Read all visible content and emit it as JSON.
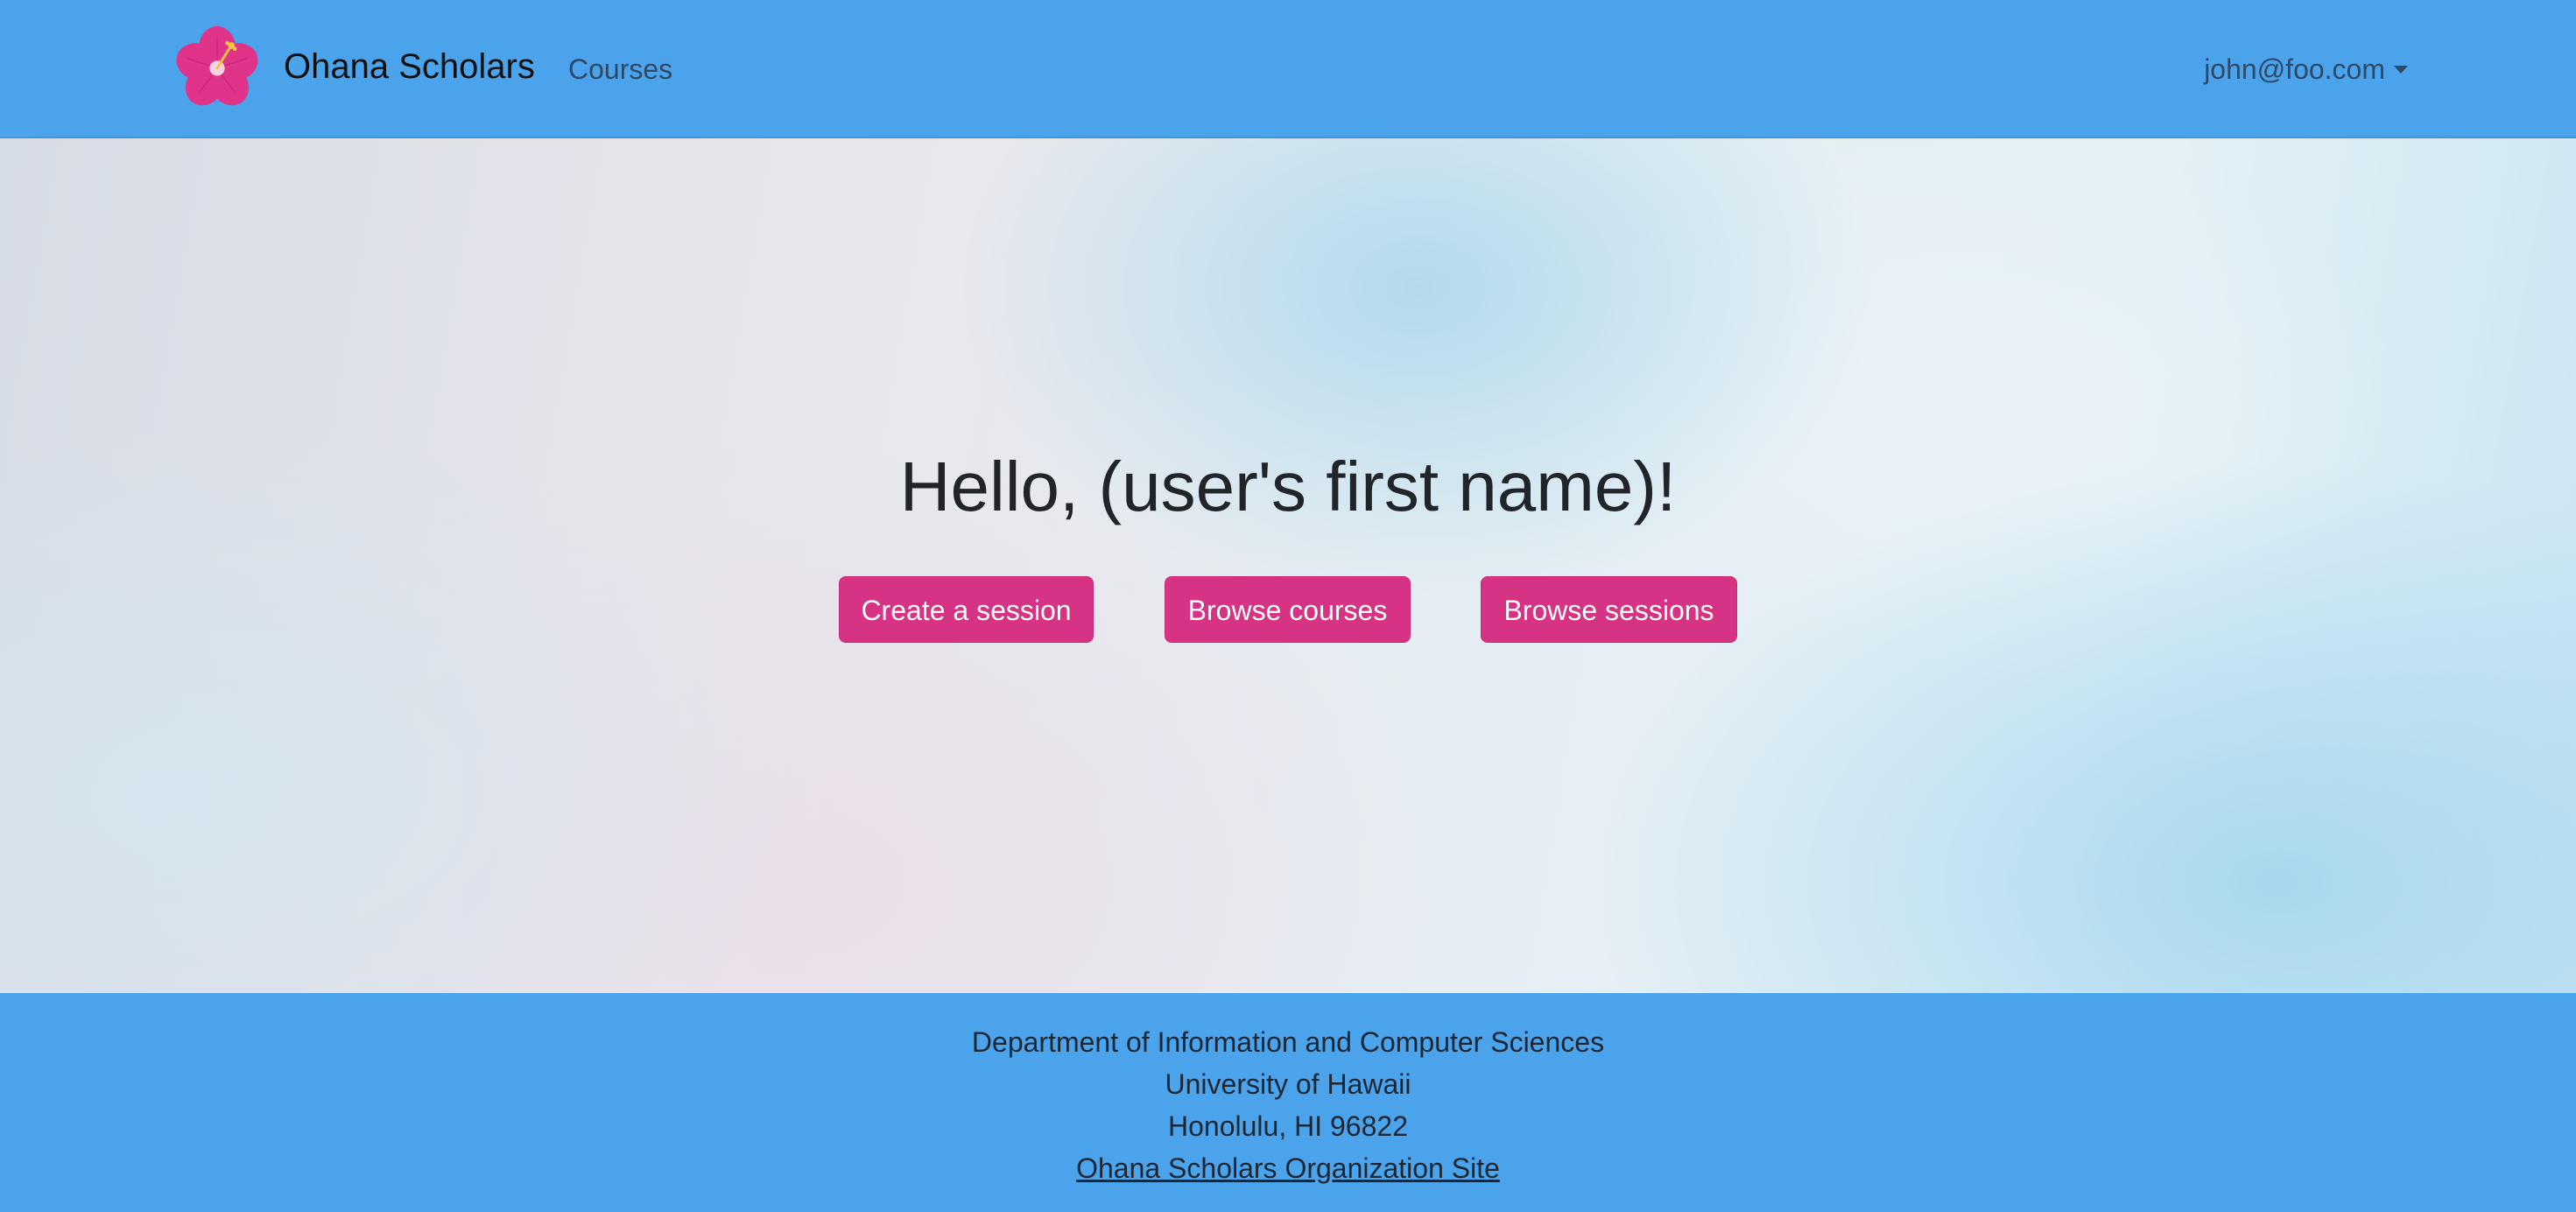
{
  "navbar": {
    "brand_name": "Ohana Scholars",
    "logo_icon": "hibiscus-flower-icon",
    "links": [
      {
        "label": "Courses"
      }
    ],
    "user_menu": {
      "label": "john@foo.com"
    }
  },
  "hero": {
    "greeting": "Hello, (user's first name)!",
    "buttons": {
      "create_session": "Create a session",
      "browse_courses": "Browse courses",
      "browse_sessions": "Browse sessions"
    }
  },
  "footer": {
    "department": "Department of Information and Computer Sciences",
    "university": "University of Hawaii",
    "address": "Honolulu, HI 96822",
    "org_link": "Ohana Scholars Organization Site"
  },
  "colors": {
    "navbar_background": "#4aa3eb",
    "button_primary": "#d63384",
    "logo_petal": "#e0338a"
  }
}
